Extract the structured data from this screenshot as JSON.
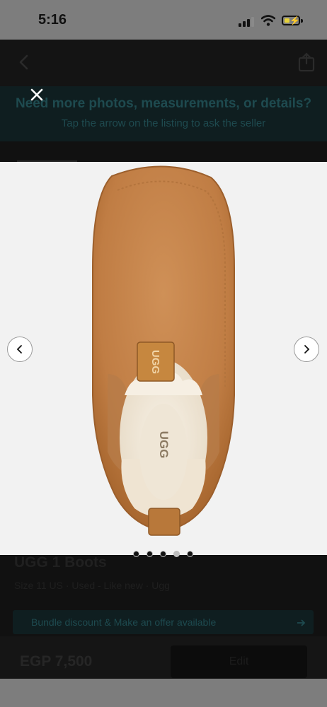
{
  "status_bar": {
    "time": "5:16"
  },
  "banner": {
    "title": "Need more photos, measurements, or details?",
    "subtitle": "Tap the arrow on the listing to ask the seller"
  },
  "gallery": {
    "image_count": 5,
    "active_index": 3
  },
  "product": {
    "title": "UGG 1 Boots",
    "meta": "Size 11 US · Used - Like new · Ugg",
    "offer_text": "Bundle discount & Make an offer available",
    "price": "EGP 7,500"
  },
  "actions": {
    "edit_label": "Edit"
  },
  "colors": {
    "accent": "#0f1e20",
    "boot": "#c7884e"
  }
}
